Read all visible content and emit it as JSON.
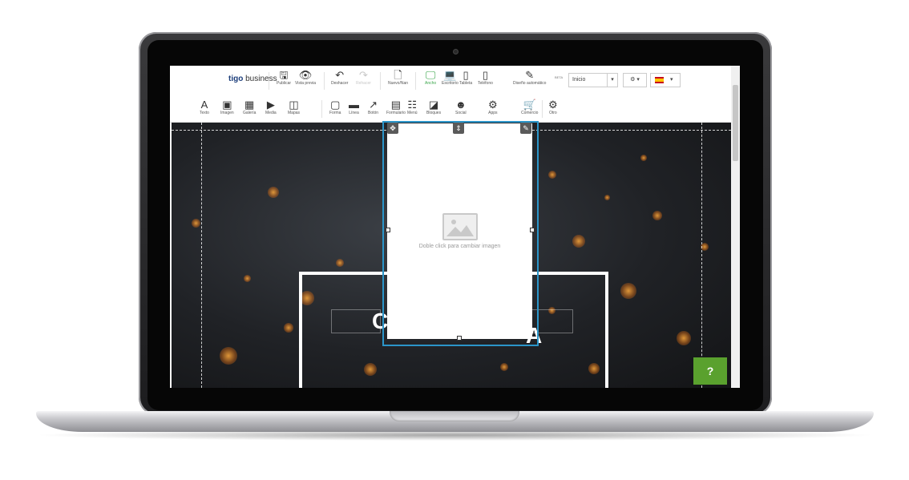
{
  "topbar": {
    "logo_brand": "tigo",
    "logo_suffix": "business",
    "tools": [
      {
        "icon": "save-icon",
        "glyph": "🖫",
        "label": "Publicar",
        "state": "normal"
      },
      {
        "icon": "eye-icon",
        "glyph": "👁",
        "label": "Vista previa",
        "state": "normal"
      },
      {
        "icon": "undo-icon",
        "glyph": "↶",
        "label": "Deshacer",
        "state": "normal"
      },
      {
        "icon": "redo-icon",
        "glyph": "↷",
        "label": "Rehacer",
        "state": "disabled"
      },
      {
        "icon": "new-page-icon",
        "glyph": "🗋",
        "label": "Nuevo/Nan",
        "state": "normal"
      },
      {
        "icon": "monitor-icon",
        "glyph": "🖵",
        "label": "Ancho",
        "state": "active"
      },
      {
        "icon": "laptop-icon",
        "glyph": "💻",
        "label": "Escritorio",
        "state": "normal"
      },
      {
        "icon": "tablet-icon",
        "glyph": "▯",
        "label": "Tableta",
        "state": "normal"
      },
      {
        "icon": "phone-icon",
        "glyph": "▯",
        "label": "Teléfono",
        "state": "normal"
      },
      {
        "icon": "magic-wand-icon",
        "glyph": "✎",
        "label": "Diseño automático",
        "state": "normal"
      }
    ],
    "beta_label": "BETA",
    "page_select": "Inicio",
    "settings_glyph": "⚙",
    "language_flag": "spain-flag-icon"
  },
  "insertbar": {
    "tools": [
      {
        "icon": "text-icon",
        "glyph": "A",
        "label": "Texto"
      },
      {
        "icon": "image-icon",
        "glyph": "▣",
        "label": "Imagen"
      },
      {
        "icon": "gallery-icon",
        "glyph": "▦",
        "label": "Galería"
      },
      {
        "icon": "media-icon",
        "glyph": "▶",
        "label": "Media"
      },
      {
        "icon": "map-icon",
        "glyph": "◫",
        "label": "Mapas"
      },
      {
        "icon": "shape-icon",
        "glyph": "▢",
        "label": "Forma"
      },
      {
        "icon": "line-icon",
        "glyph": "▬",
        "label": "Línea"
      },
      {
        "icon": "button-icon",
        "glyph": "↗",
        "label": "Botón"
      },
      {
        "icon": "form-icon",
        "glyph": "▤",
        "label": "Formulario"
      },
      {
        "icon": "menu-icon",
        "glyph": "☷",
        "label": "Menú"
      },
      {
        "icon": "blocks-icon",
        "glyph": "◪",
        "label": "Bloques"
      },
      {
        "icon": "social-icon",
        "glyph": "☻",
        "label": "Social"
      },
      {
        "icon": "apps-icon",
        "glyph": "⚙",
        "label": "Apps"
      },
      {
        "icon": "cart-icon",
        "glyph": "🛒",
        "label": "Comercio"
      },
      {
        "icon": "other-icon",
        "glyph": "⚙",
        "label": "Otro"
      }
    ]
  },
  "canvas": {
    "headline_left": "C",
    "headline_right": "A",
    "placeholder_text": "Doble click para cambiar imagen",
    "help_label": "?"
  },
  "colors": {
    "accent": "#2b95c9",
    "active_green": "#3aa64a",
    "help_green": "#5aa12e",
    "brand_blue": "#1b3d7a"
  }
}
